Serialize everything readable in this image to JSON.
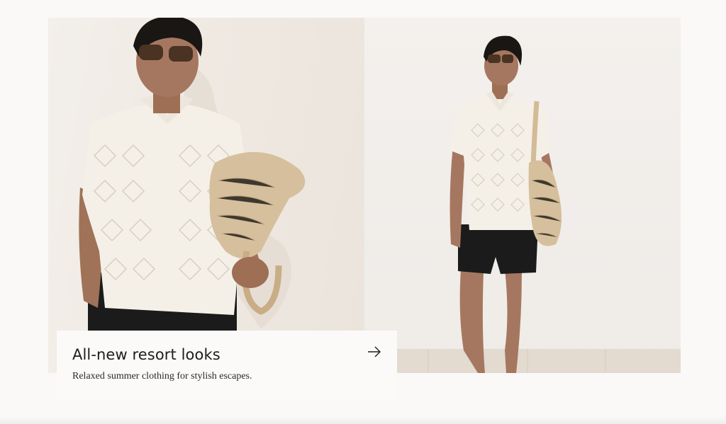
{
  "promo": {
    "title": "All-new resort looks",
    "subtitle": "Relaxed summer clothing for stylish escapes.",
    "arrow_icon": "arrow-right-icon"
  },
  "images": [
    {
      "name": "resort-look-photo-left"
    },
    {
      "name": "resort-look-photo-right"
    }
  ],
  "colors": {
    "background": "#faf9f8",
    "text": "#1d1d1d",
    "card": "#fbfaf9"
  }
}
